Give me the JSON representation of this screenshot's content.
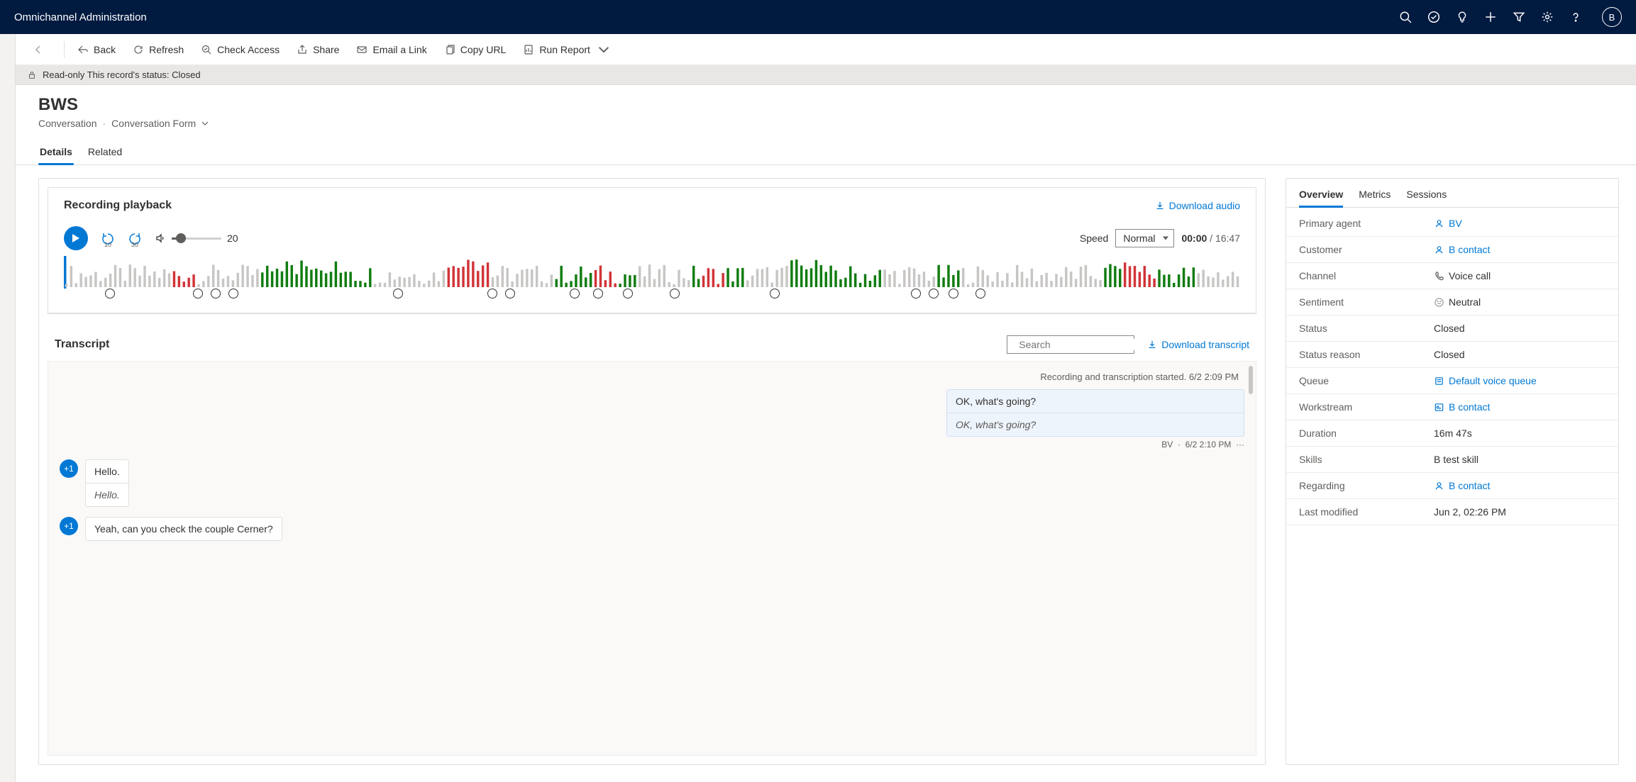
{
  "app_title": "Omnichannel Administration",
  "avatar_initial": "B",
  "commands": {
    "back": "Back",
    "refresh": "Refresh",
    "check_access": "Check Access",
    "share": "Share",
    "email_link": "Email a Link",
    "copy_url": "Copy URL",
    "run_report": "Run Report"
  },
  "readonly_banner": "Read-only  This record's status: Closed",
  "record": {
    "title": "BWS",
    "entity": "Conversation",
    "form": "Conversation Form"
  },
  "tabs": {
    "details": "Details",
    "related": "Related"
  },
  "recording": {
    "title": "Recording playback",
    "download": "Download audio",
    "vol_value": "20",
    "speed_label": "Speed",
    "speed_value": "Normal",
    "time_current": "00:00",
    "time_total": "16:47"
  },
  "transcript": {
    "title": "Transcript",
    "search_placeholder": "Search",
    "download": "Download transcript",
    "system": "Recording and transcription started. 6/2 2:09 PM",
    "agent_msg": {
      "text": "OK, what's going?",
      "translated": "OK, what's going?",
      "author": "BV",
      "time": "6/2 2:10 PM"
    },
    "cust1": {
      "badge": "+1",
      "text": "Hello.",
      "translated": "Hello."
    },
    "cust2": {
      "badge": "+1",
      "text": "Yeah, can you check the couple Cerner?"
    }
  },
  "side_tabs": {
    "overview": "Overview",
    "metrics": "Metrics",
    "sessions": "Sessions"
  },
  "overview": {
    "primary_agent_k": "Primary agent",
    "primary_agent_v": "BV",
    "customer_k": "Customer",
    "customer_v": "B contact",
    "channel_k": "Channel",
    "channel_v": "Voice call",
    "sentiment_k": "Sentiment",
    "sentiment_v": "Neutral",
    "status_k": "Status",
    "status_v": "Closed",
    "status_reason_k": "Status reason",
    "status_reason_v": "Closed",
    "queue_k": "Queue",
    "queue_v": "Default voice queue",
    "workstream_k": "Workstream",
    "workstream_v": "B contact",
    "duration_k": "Duration",
    "duration_v": "16m 47s",
    "skills_k": "Skills",
    "skills_v": "B test skill",
    "regarding_k": "Regarding",
    "regarding_v": "B contact",
    "modified_k": "Last modified",
    "modified_v": "Jun 2, 02:26 PM"
  }
}
